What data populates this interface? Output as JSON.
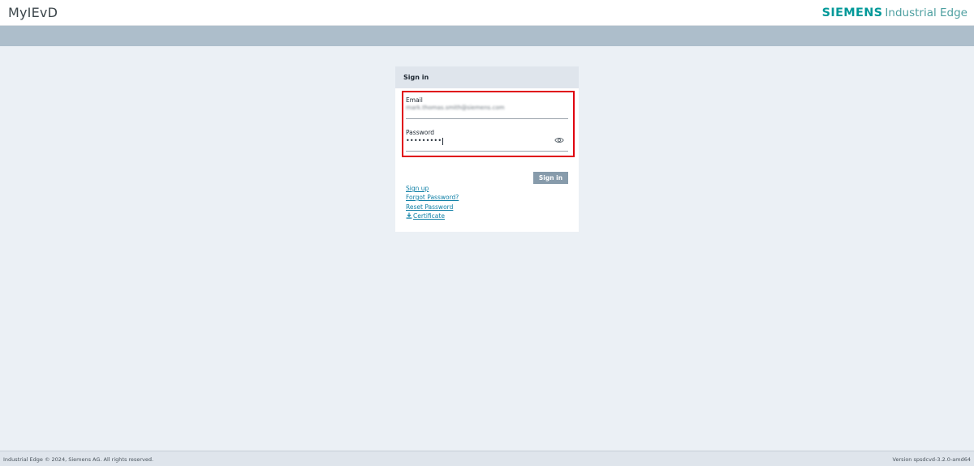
{
  "header": {
    "app_title": "MyIEvD",
    "brand_company": "SIEMENS",
    "brand_product": "Industrial Edge"
  },
  "signin": {
    "title": "Sign in",
    "email_label": "Email",
    "email_value": "mark.thomas.smith@siemens.com",
    "password_label": "Password",
    "password_masked": "•••••••••",
    "submit_label": "Sign in",
    "links": {
      "signup": "Sign up",
      "forgot": "Forgot Password?",
      "reset": "Reset Password",
      "certificate": "Certificate"
    }
  },
  "footer": {
    "copyright": "Industrial Edge © 2024, Siemens AG. All rights reserved.",
    "version": "Version spsdcvd-3.2.0-amd64"
  },
  "colors": {
    "brand": "#009999",
    "highlight": "#e0000f",
    "button": "#879bab",
    "link": "#0e7fa6"
  },
  "icons": [
    "eye-icon",
    "download-icon"
  ]
}
